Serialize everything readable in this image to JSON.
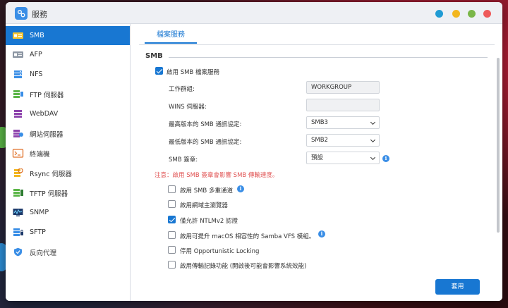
{
  "window": {
    "title": "服務"
  },
  "sidebar": {
    "items": [
      {
        "label": "SMB",
        "icon": "smb-icon"
      },
      {
        "label": "AFP",
        "icon": "afp-icon"
      },
      {
        "label": "NFS",
        "icon": "nfs-icon"
      },
      {
        "label": "FTP 伺服器",
        "icon": "ftp-server-icon"
      },
      {
        "label": "WebDAV",
        "icon": "webdav-icon"
      },
      {
        "label": "網站伺服器",
        "icon": "web-server-icon"
      },
      {
        "label": "終端機",
        "icon": "terminal-icon"
      },
      {
        "label": "Rsync 伺服器",
        "icon": "rsync-server-icon"
      },
      {
        "label": "TFTP 伺服器",
        "icon": "tftp-server-icon"
      },
      {
        "label": "SNMP",
        "icon": "snmp-icon"
      },
      {
        "label": "SFTP",
        "icon": "sftp-icon"
      },
      {
        "label": "反向代理",
        "icon": "reverse-proxy-icon"
      }
    ],
    "active_index": 0
  },
  "tab": {
    "label": "檔案服務"
  },
  "smb": {
    "section_title": "SMB",
    "enable": {
      "label": "啟用 SMB 檔案服務",
      "checked": true
    },
    "workgroup": {
      "label": "工作群組:",
      "value": "WORKGROUP"
    },
    "wins": {
      "label": "WINS 伺服器:",
      "value": ""
    },
    "max_protocol": {
      "label": "最高版本的 SMB 通訊協定:",
      "value": "SMB3"
    },
    "min_protocol": {
      "label": "最低版本的 SMB 通訊協定:",
      "value": "SMB2"
    },
    "signing": {
      "label": "SMB 簽章:",
      "value": "預設"
    },
    "warning": "注意：啟用 SMB 簽章會影響 SMB 傳輸速度。",
    "options": [
      {
        "label": "啟用 SMB 多重通道",
        "checked": false,
        "info": true
      },
      {
        "label": "啟用網域主瀏覽器",
        "checked": false,
        "info": false
      },
      {
        "label": "僅允許 NTLMv2 認證",
        "checked": true,
        "info": false
      },
      {
        "label": "啟用可提升 macOS 相容性的 Samba VFS 模組。",
        "checked": false,
        "info": true
      },
      {
        "label": "停用 Opportunistic Locking",
        "checked": false,
        "info": false
      },
      {
        "label": "啟用傳輸記錄功能 (開啟後可能會影響系統效能)",
        "checked": false,
        "info": false
      }
    ]
  },
  "footer": {
    "apply_label": "套用"
  },
  "colors": {
    "accent": "#1877d2",
    "warning": "#e05252"
  }
}
